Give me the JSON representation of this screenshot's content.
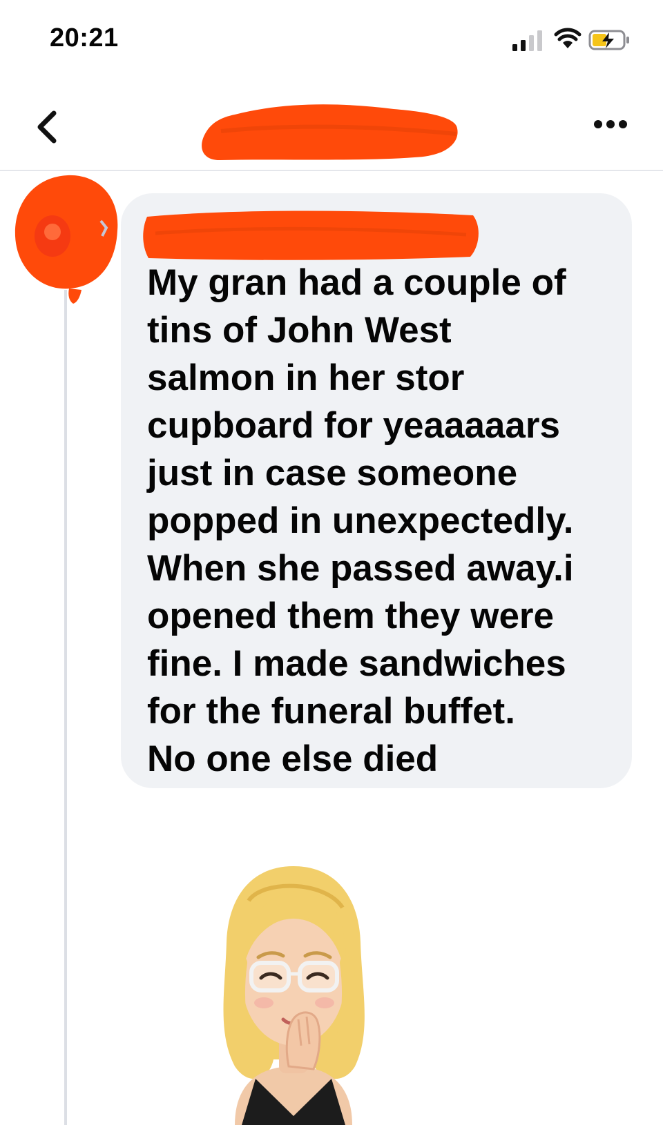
{
  "status_bar": {
    "time": "20:21",
    "icons": [
      "signal-icon",
      "wifi-icon",
      "battery-charging-icon"
    ]
  },
  "header": {
    "back_icon": "chevron-left-icon",
    "more_icon": "more-horizontal-icon",
    "name_redacted": true
  },
  "comment": {
    "author_redacted": true,
    "text_lines": [
      "My gran had a couple of",
      "tins of John West",
      "salmon in her stor",
      "cupboard for yeaaaaars",
      "just in case someone",
      "popped in unexpectedly.",
      "When she passed away.i",
      "opened them they were",
      "fine. I made sandwiches",
      "for the funeral buffet.",
      "No one else died"
    ]
  },
  "sticker": {
    "icon": "avatar-sticker-giggling-woman"
  },
  "colors": {
    "redaction": "#ff4a0a",
    "bubble": "#f0f2f5",
    "text": "#050505",
    "divider": "#e4e6eb"
  }
}
